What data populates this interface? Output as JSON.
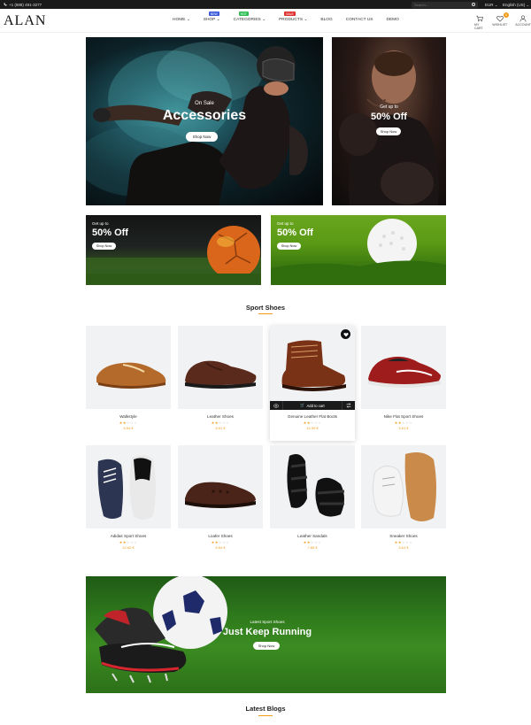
{
  "topbar": {
    "phone": "+1 (888) 491-3277",
    "search_placeholder": "Search...",
    "currency": "EUR",
    "language": "English (US)"
  },
  "header": {
    "logo": "ALAN",
    "nav": [
      {
        "label": "HOME",
        "has_dropdown": true,
        "badge": ""
      },
      {
        "label": "SHOP",
        "has_dropdown": true,
        "badge": "NEW",
        "badge_color": "#3b5bdb"
      },
      {
        "label": "CATEGORIES",
        "has_dropdown": true,
        "badge": "HOT",
        "badge_color": "#2fbf55"
      },
      {
        "label": "PRODUCTS",
        "has_dropdown": true,
        "badge": "SALE",
        "badge_color": "#e03131"
      },
      {
        "label": "BLOG",
        "has_dropdown": false,
        "badge": ""
      },
      {
        "label": "CONTACT US",
        "has_dropdown": false,
        "badge": ""
      },
      {
        "label": "DEMO",
        "has_dropdown": false,
        "badge": ""
      }
    ],
    "icons": {
      "cart_label": "MY CART",
      "wishlist_label": "WISHLIST",
      "wishlist_count": "0",
      "account_label": "ACCOUNT"
    }
  },
  "hero": {
    "kicker": "On Sale",
    "title": "Accessories",
    "button": "Shop Now",
    "slides": 2,
    "active_slide": 1
  },
  "side_banner": {
    "kicker": "Get up to",
    "title": "50% Off",
    "button": "Shop Now"
  },
  "promos": [
    {
      "kicker": "Get up to",
      "title": "50% Off",
      "button": "Shop Now"
    },
    {
      "kicker": "Get up to",
      "title": "50% Off",
      "button": "Shop Now"
    }
  ],
  "sport_shoes": {
    "title": "Sport Shoes",
    "products": [
      {
        "name": "Walkstyle",
        "rating": 2,
        "price": "6.54 €"
      },
      {
        "name": "Leather Shoes",
        "rating": 2,
        "price": "6.91 €"
      },
      {
        "name": "Genuine Leather Flat Boots",
        "rating": 2,
        "price": "14.39 €",
        "add_to_cart": "Add to cart"
      },
      {
        "name": "Nike Flat Sport Shoes",
        "rating": 2,
        "price": "5.61 €"
      },
      {
        "name": "Adidas Sport Shoes",
        "rating": 2,
        "price": "10.62 €"
      },
      {
        "name": "Loafer Shoes",
        "rating": 2,
        "price": "6.54 €"
      },
      {
        "name": "Leather Sandals",
        "rating": 2,
        "price": "7.85 €"
      },
      {
        "name": "Sneaker Shoes",
        "rating": 2,
        "price": "5.61 €"
      }
    ]
  },
  "run_banner": {
    "kicker": "Latest Sport Shoes",
    "title": "Just Keep Running",
    "button": "Shop Now"
  },
  "blogs": {
    "title": "Latest Blogs"
  },
  "colors": {
    "accent": "#f19b1a",
    "topbar": "#1a1a1a",
    "product_bg": "#f1f2f4"
  }
}
